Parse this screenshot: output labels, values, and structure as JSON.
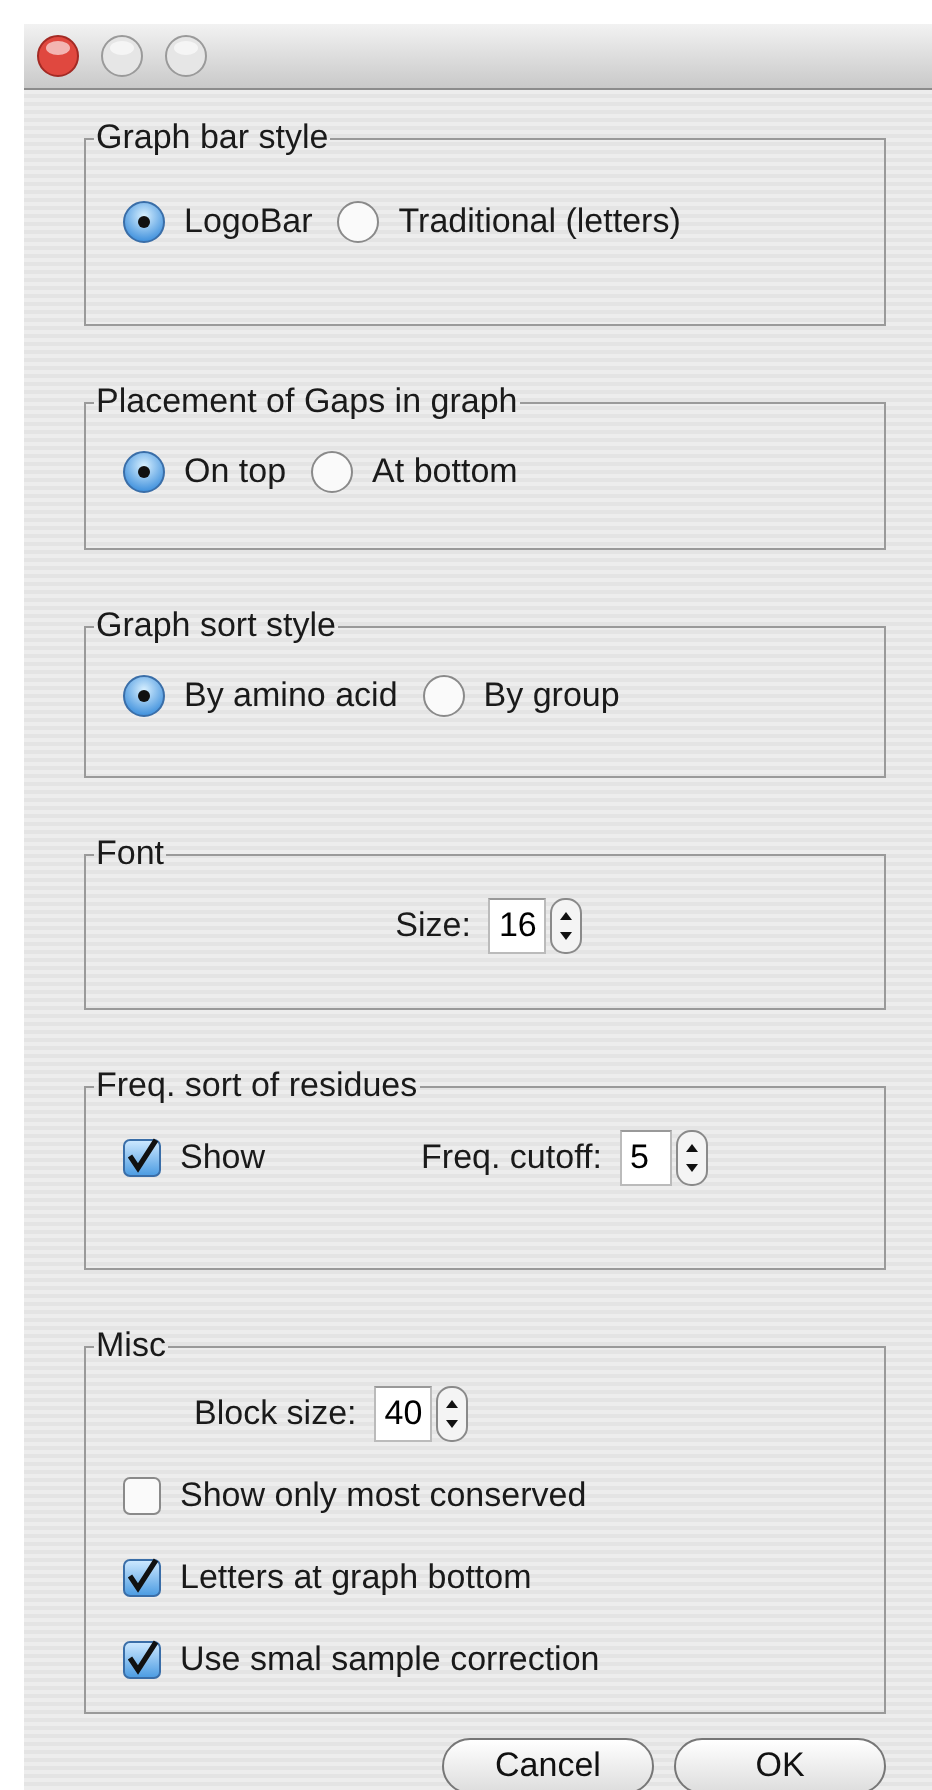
{
  "groups": [
    {
      "title": "Graph bar style",
      "rows": [
        [
          {
            "kind": "radio",
            "label": "LogoBar",
            "selected": true
          },
          {
            "kind": "radio",
            "label": "Traditional (letters)",
            "selected": false
          }
        ]
      ]
    },
    {
      "title": "Placement of Gaps in graph",
      "rows": [
        [
          {
            "kind": "radio",
            "label": "On top",
            "selected": true
          },
          {
            "kind": "radio",
            "label": "At bottom",
            "selected": false
          }
        ]
      ]
    },
    {
      "title": "Graph sort style",
      "rows": [
        [
          {
            "kind": "radio",
            "label": "By amino acid",
            "selected": true
          },
          {
            "kind": "radio",
            "label": "By group",
            "selected": false
          }
        ]
      ]
    },
    {
      "title": "Font",
      "rows": [
        [
          {
            "kind": "spinner",
            "label": "Size:",
            "value": "16"
          }
        ]
      ]
    },
    {
      "title": "Freq. sort of residues",
      "rows": [
        [
          {
            "kind": "checkbox",
            "label": "Show",
            "checked": true
          },
          {
            "kind": "spinner",
            "label": "Freq. cutoff:",
            "value": "5"
          }
        ]
      ]
    },
    {
      "title": "Misc",
      "rows": [
        [
          {
            "kind": "spinner",
            "label": "Block size:",
            "value": "40"
          }
        ],
        [
          {
            "kind": "checkbox",
            "label": "Show only most conserved",
            "checked": false
          }
        ],
        [
          {
            "kind": "checkbox",
            "label": "Letters at graph bottom",
            "checked": true
          }
        ],
        [
          {
            "kind": "checkbox",
            "label": "Use smal sample correction",
            "checked": true
          }
        ]
      ]
    }
  ],
  "buttons": [
    {
      "label": "Cancel"
    },
    {
      "label": "OK"
    }
  ]
}
